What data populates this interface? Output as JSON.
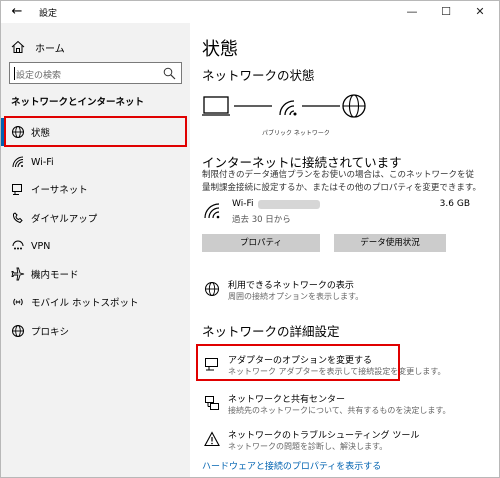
{
  "window": {
    "title": "設定",
    "back": "←",
    "minimize": "—",
    "maximize": "☐",
    "close": "✕"
  },
  "sidebar": {
    "home_label": "ホーム",
    "search_placeholder": "設定の検索",
    "section_title": "ネットワークとインターネット",
    "items": [
      {
        "label": "状態",
        "icon": "globe-status-icon",
        "active": true
      },
      {
        "label": "Wi-Fi",
        "icon": "wifi-icon"
      },
      {
        "label": "イーサネット",
        "icon": "ethernet-icon"
      },
      {
        "label": "ダイヤルアップ",
        "icon": "dialup-icon"
      },
      {
        "label": "VPN",
        "icon": "vpn-icon"
      },
      {
        "label": "機内モード",
        "icon": "airplane-icon"
      },
      {
        "label": "モバイル ホットスポット",
        "icon": "hotspot-icon"
      },
      {
        "label": "プロキシ",
        "icon": "proxy-globe-icon"
      }
    ]
  },
  "main": {
    "title": "状態",
    "network_status_heading": "ネットワークの状態",
    "diagram_caption": "パブリック ネットワーク",
    "connected_heading": "インターネットに接続されています",
    "connected_desc": "制限付きのデータ通信プランをお使いの場合は、このネットワークを従量制課金接続に設定するか、またはその他のプロパティを変更できます。",
    "wifi": {
      "name": "Wi-Fi",
      "sub": "過去 30 日から",
      "usage": "3.6 GB"
    },
    "buttons": {
      "properties": "プロパティ",
      "data_usage": "データ使用状況"
    },
    "available_networks": {
      "title": "利用できるネットワークの表示",
      "desc": "周囲の接続オプションを表示します。"
    },
    "advanced_heading": "ネットワークの詳細設定",
    "adapter_options": {
      "title": "アダプターのオプションを変更する",
      "desc": "ネットワーク アダプターを表示して接続設定を変更します。"
    },
    "sharing_center": {
      "title": "ネットワークと共有センター",
      "desc": "接続先のネットワークについて、共有するものを決定します。"
    },
    "troubleshoot": {
      "title": "ネットワークのトラブルシューティング ツール",
      "desc": "ネットワークの問題を診断し、解決します。"
    },
    "hardware_link": "ハードウェアと接続のプロパティを表示する"
  },
  "colors": {
    "accent": "#0063b1",
    "highlight": "#e00000",
    "sidebar_bg": "#f2f2f2",
    "button_bg": "#cccccc"
  }
}
